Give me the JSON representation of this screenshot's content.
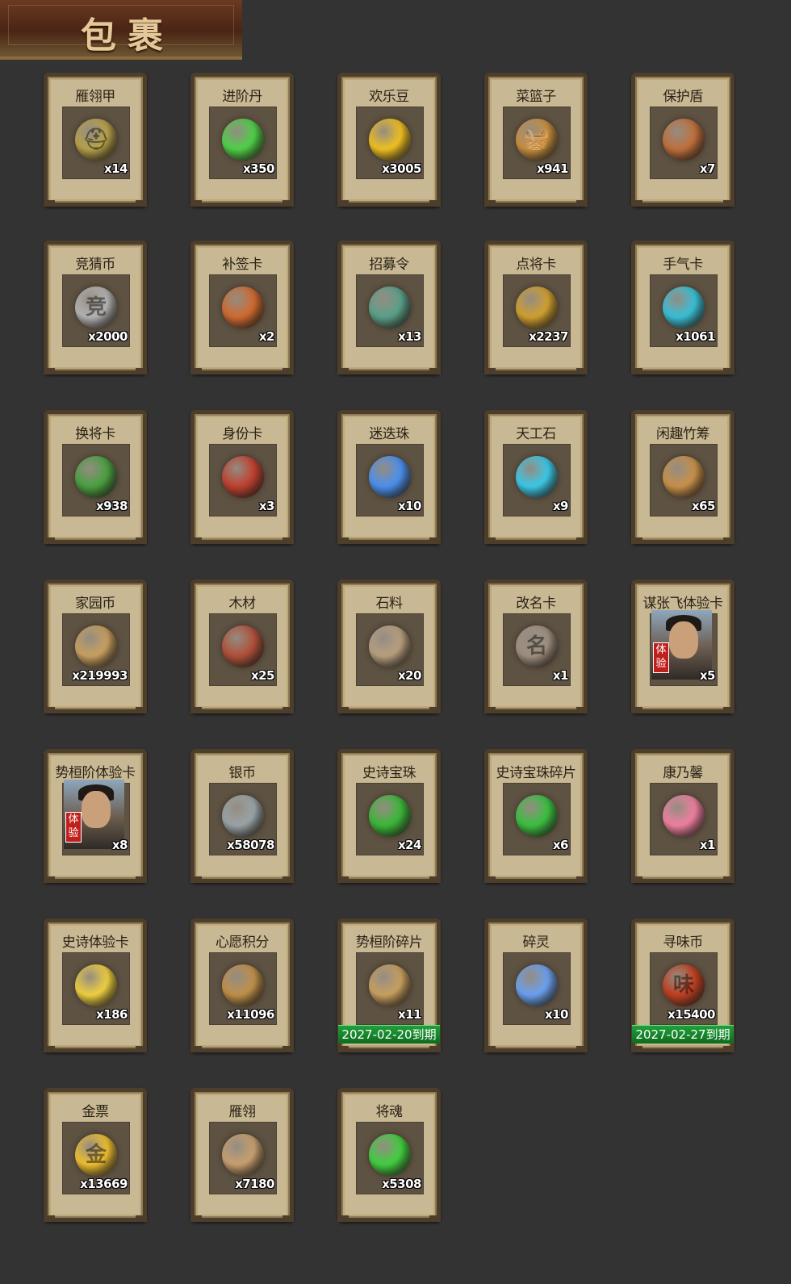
{
  "header": {
    "title": "包裹"
  },
  "items": [
    {
      "name": "雁翎甲",
      "count": "x14",
      "icon": "helmet-icon",
      "glyph": "⛑",
      "color": "#b8a24a"
    },
    {
      "name": "进阶丹",
      "count": "x350",
      "icon": "green-pill-icon",
      "glyph": "",
      "color": "#4fd048"
    },
    {
      "name": "欢乐豆",
      "count": "x3005",
      "icon": "gold-beans-icon",
      "glyph": "",
      "color": "#f0c020"
    },
    {
      "name": "菜篮子",
      "count": "x941",
      "icon": "basket-icon",
      "glyph": "🧺",
      "color": "#c89040"
    },
    {
      "name": "保护盾",
      "count": "x7",
      "icon": "shield-icon",
      "glyph": "",
      "color": "#c0703c"
    },
    {
      "name": "竞猜币",
      "count": "x2000",
      "icon": "silver-coin-icon",
      "glyph": "竞",
      "color": "#b4b4b4"
    },
    {
      "name": "补签卡",
      "count": "x2",
      "icon": "token-icon",
      "glyph": "",
      "color": "#d06a30"
    },
    {
      "name": "招募令",
      "count": "x13",
      "icon": "recruit-token-icon",
      "glyph": "",
      "color": "#5aa08a"
    },
    {
      "name": "点将卡",
      "count": "x2237",
      "icon": "general-card-icon",
      "glyph": "",
      "color": "#d0a030"
    },
    {
      "name": "手气卡",
      "count": "x1061",
      "icon": "luck-card-icon",
      "glyph": "",
      "color": "#38c0d8"
    },
    {
      "name": "换将卡",
      "count": "x938",
      "icon": "swap-card-icon",
      "glyph": "",
      "color": "#4aa040"
    },
    {
      "name": "身份卡",
      "count": "x3",
      "icon": "mask-card-icon",
      "glyph": "",
      "color": "#c04030"
    },
    {
      "name": "迷迭珠",
      "count": "x10",
      "icon": "blue-orb-icon",
      "glyph": "",
      "color": "#4a90f0"
    },
    {
      "name": "天工石",
      "count": "x9",
      "icon": "crystal-icon",
      "glyph": "",
      "color": "#3ac8e8"
    },
    {
      "name": "闲趣竹筹",
      "count": "x65",
      "icon": "bamboo-tally-icon",
      "glyph": "",
      "color": "#c8904a"
    },
    {
      "name": "家园币",
      "count": "x219993",
      "icon": "home-coin-icon",
      "glyph": "",
      "color": "#c8a060"
    },
    {
      "name": "木材",
      "count": "x25",
      "icon": "wood-icon",
      "glyph": "",
      "color": "#b0503a"
    },
    {
      "name": "石料",
      "count": "x20",
      "icon": "stone-icon",
      "glyph": "",
      "color": "#b8a080"
    },
    {
      "name": "改名卡",
      "count": "x1",
      "icon": "rename-card-icon",
      "glyph": "名",
      "color": "#a09080"
    },
    {
      "name": "谋张飞体验卡",
      "count": "x5",
      "icon": "portrait-zhangfei-icon",
      "glyph": "",
      "color": "#8a6c50",
      "portrait": true,
      "badge": "体验"
    },
    {
      "name": "势桓阶体验卡",
      "count": "x8",
      "icon": "portrait-general-icon",
      "glyph": "",
      "color": "#8a6c50",
      "portrait": true,
      "badge": "体验"
    },
    {
      "name": "银币",
      "count": "x58078",
      "icon": "silver-coins-icon",
      "glyph": "",
      "color": "#9aa4a8"
    },
    {
      "name": "史诗宝珠",
      "count": "x24",
      "icon": "green-orb-icon",
      "glyph": "",
      "color": "#3ab838"
    },
    {
      "name": "史诗宝珠碎片",
      "count": "x6",
      "icon": "green-shard-icon",
      "glyph": "",
      "color": "#3ac040"
    },
    {
      "name": "康乃馨",
      "count": "x1",
      "icon": "carnation-icon",
      "glyph": "",
      "color": "#f080a0"
    },
    {
      "name": "史诗体验卡",
      "count": "x186",
      "icon": "gold-card-icon",
      "glyph": "",
      "color": "#f0d040"
    },
    {
      "name": "心愿积分",
      "count": "x11096",
      "icon": "heart-coin-icon",
      "glyph": "",
      "color": "#c0904a"
    },
    {
      "name": "势桓阶碎片",
      "count": "x11",
      "icon": "puzzle-portrait-icon",
      "glyph": "",
      "color": "#c8a060",
      "expire": "2027-02-20到期"
    },
    {
      "name": "碎灵",
      "count": "x10",
      "icon": "blue-crystal-shard-icon",
      "glyph": "",
      "color": "#6aa0f0"
    },
    {
      "name": "寻味币",
      "count": "x15400",
      "icon": "flavor-coin-icon",
      "glyph": "味",
      "color": "#c04020",
      "expire": "2027-02-27到期"
    },
    {
      "name": "金票",
      "count": "x13669",
      "icon": "gold-ticket-icon",
      "glyph": "金",
      "color": "#f0c030"
    },
    {
      "name": "雁翎",
      "count": "x7180",
      "icon": "feather-icon",
      "glyph": "",
      "color": "#c8a070"
    },
    {
      "name": "将魂",
      "count": "x5308",
      "icon": "green-soul-crystal-icon",
      "glyph": "",
      "color": "#40d040"
    }
  ]
}
